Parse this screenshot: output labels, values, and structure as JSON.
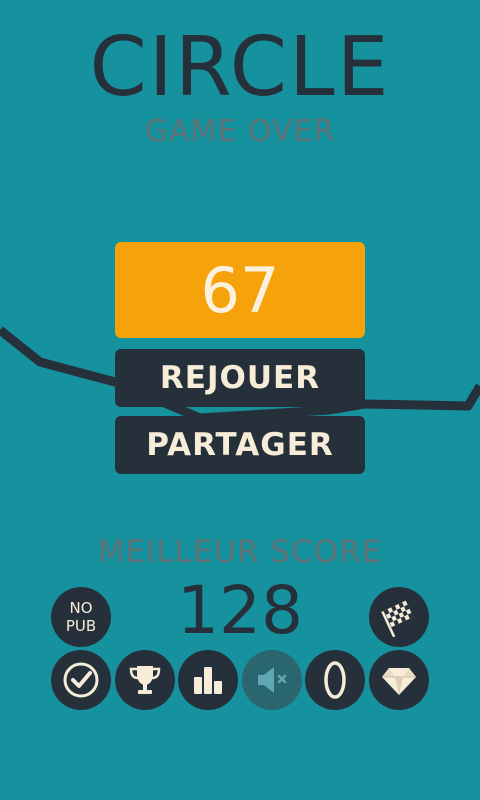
{
  "game": {
    "title": "CIRCLE",
    "status": "GAME OVER",
    "score": "67"
  },
  "menu": {
    "replay_label": "REJOUER",
    "share_label": "PARTAGER"
  },
  "best": {
    "label": "MEILLEUR SCORE",
    "value": "128"
  },
  "toolbar": {
    "no_ads_line1": "NO",
    "no_ads_line2": "PUB",
    "icons": [
      "checkmark-icon",
      "trophy-icon",
      "leaderboard-icon",
      "sound-muted-icon",
      "ring-icon",
      "diamond-icon",
      "checkered-flag-icon"
    ],
    "sound_muted": true
  },
  "colors": {
    "background": "#16919e",
    "dark": "#26303a",
    "accent": "#f6a20a",
    "light_text": "#f6ecd8",
    "muted_text": "#5f7276"
  }
}
